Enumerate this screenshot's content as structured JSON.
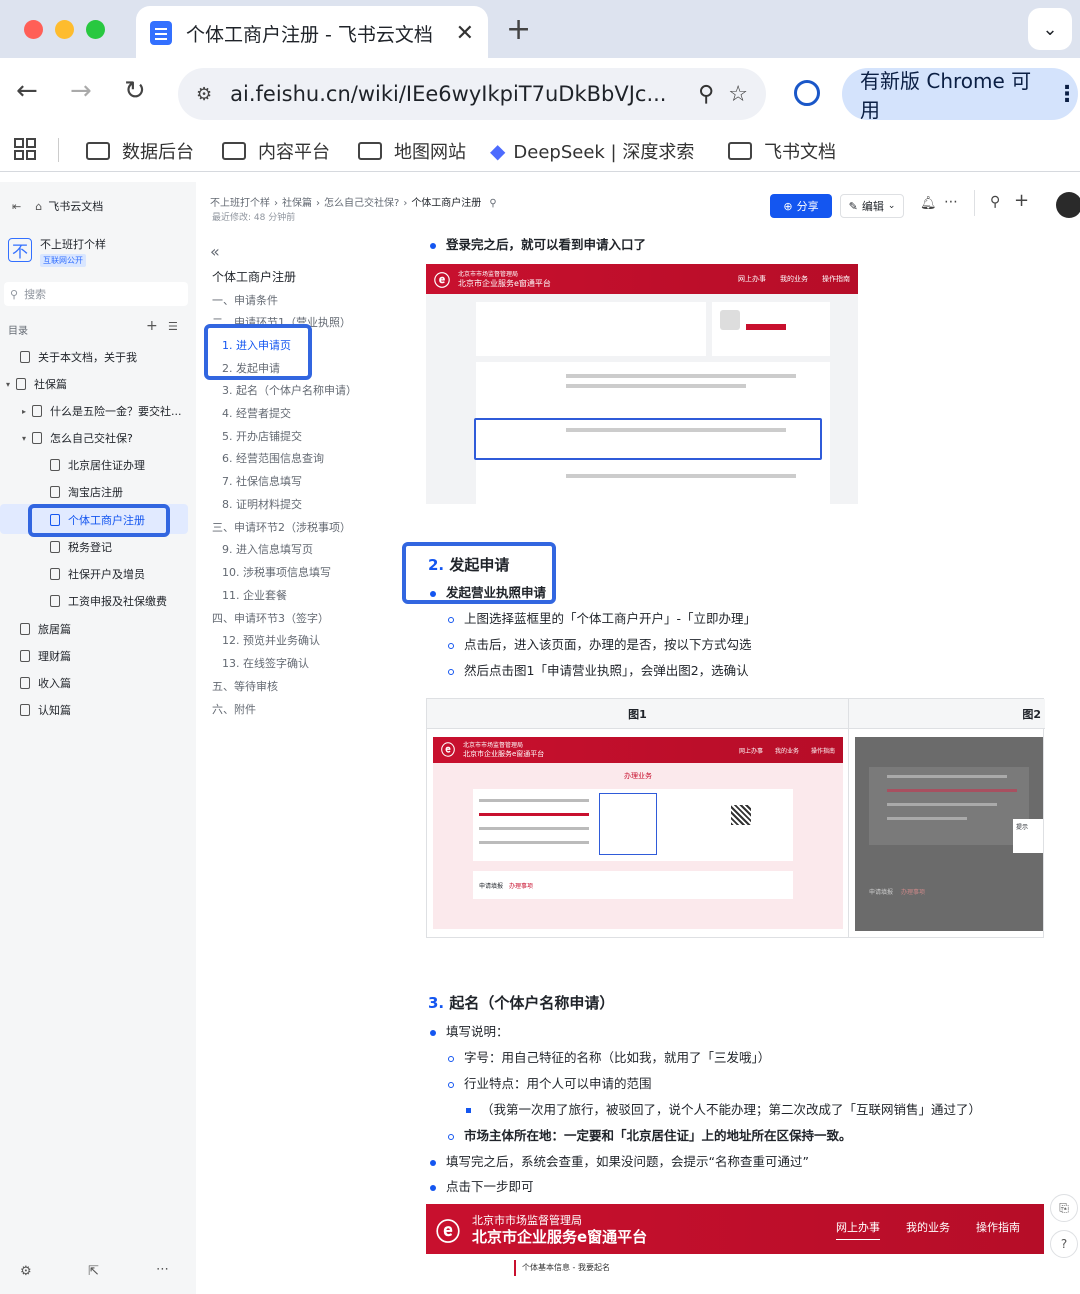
{
  "browser": {
    "tab_title": "个体工商户注册 - 飞书云文档",
    "url": "ai.feishu.cn/wiki/IEe6wyIkpiT7uDkBbVJc...",
    "update_button": "有新版 Chrome 可用",
    "bookmarks": [
      "数据后台",
      "内容平台",
      "地图网站",
      "DeepSeek | 深度求索",
      "飞书文档"
    ]
  },
  "sidebar": {
    "home": "飞书云文档",
    "space_name": "不上班打个样",
    "space_badge": "互联网公开",
    "space_logo": "不",
    "search_placeholder": "搜索",
    "toc_label": "目录",
    "items": [
      "关于本文档，关于我",
      "社保篇",
      "什么是五险一金？要交社...",
      "怎么自己交社保?",
      "北京居住证办理",
      "淘宝店注册",
      "个体工商户注册",
      "税务登记",
      "社保开户及增员",
      "工资申报及社保缴费",
      "旅居篇",
      "理财篇",
      "收入篇",
      "认知篇"
    ]
  },
  "header": {
    "breadcrumb": [
      "不上班打个样",
      "社保篇",
      "怎么自己交社保?",
      "个体工商户注册"
    ],
    "last_modified": "最近修改: 48 分钟前",
    "share": "分享",
    "edit": "编辑"
  },
  "outline": {
    "title": "个体工商户注册",
    "items": [
      "一、申请条件",
      "二、申请环节1（营业执照）",
      "1. 进入申请页",
      "2. 发起申请",
      "3. 起名（个体户名称申请）",
      "4. 经营者提交",
      "5. 开办店铺提交",
      "6. 经营范围信息查询",
      "7. 社保信息填写",
      "8. 证明材料提交",
      "三、申请环节2（涉税事项）",
      "9. 进入信息填写页",
      "10. 涉税事项信息填写",
      "11. 企业套餐",
      "四、申请环节3（签字）",
      "12. 预览并业务确认",
      "13. 在线签字确认",
      "五、等待审核",
      "六、附件"
    ]
  },
  "doc": {
    "line1": "登录完之后，就可以看到申请入口了",
    "h2_num": "2.",
    "h2_text": "发起申请",
    "b_start": "发起营业执照申请",
    "sub": [
      "上图选择蓝框里的「个体工商户开户」-「立即办理」",
      "点击后，进入该页面，办理的是否，按以下方式勾选",
      "然后点击图1「申请营业执照」，会弹出图2，选确认"
    ],
    "table_headers": [
      "图1",
      "图2"
    ],
    "h3_num": "3.",
    "h3_text": "起名（个体户名称申请）",
    "fill_note": "填写说明：",
    "fill_items": [
      "字号：用自己特征的名称（比如我，就用了「三发哦」）",
      "行业特点：用个人可以申请的范围"
    ],
    "nested": "（我第一次用了旅行，被驳回了，说个人不能办理；第二次改成了「互联网销售」通过了）",
    "market_label": "市场主体所在地：",
    "market_text": "一定要和「北京居住证」上的地址所在区保持一致。",
    "after_fill": "填写完之后，系统会查重，如果没问题，会提示“名称查重可通过”",
    "click_next": "点击下一步即可"
  },
  "portal": {
    "org": "北京市市场监督管理局",
    "name": "北京市企业服务e窗通平台",
    "nav": [
      "网上办事",
      "我的业务",
      "操作指南"
    ],
    "section": "办理业务",
    "tip": "提示",
    "name_tab": "个体基本信息 - 我要起名",
    "apply_tab": "办理事项",
    "apply_label": "申请填报"
  },
  "colors": {
    "accent": "#1456f0",
    "highlight": "#3266e0",
    "portal_red": "#c8102e"
  }
}
